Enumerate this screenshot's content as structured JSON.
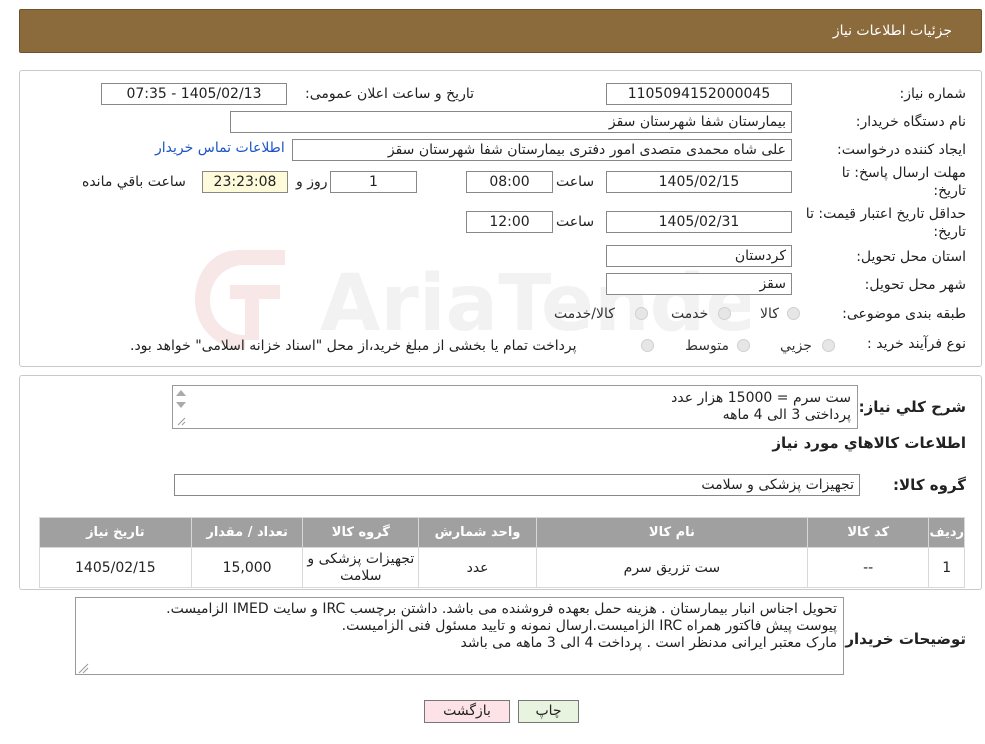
{
  "header": {
    "title": "جزئیات اطلاعات نیاز"
  },
  "form": {
    "need_number_label": "شماره نیاز:",
    "need_number": "1105094152000045",
    "announce_label": "تاریخ و ساعت اعلان عمومی:",
    "announce_value": "1405/02/13 - 07:35",
    "buyer_org_label": "نام دستگاه خریدار:",
    "buyer_org": "بیمارستان شفا شهرستان سقز",
    "creator_label": "ایجاد کننده درخواست:",
    "creator": "علی شاه محمدی متصدی امور دفتری بیمارستان شفا شهرستان سقز",
    "contact_link": "اطلاعات تماس خریدار",
    "deadline_label_1": "مهلت ارسال پاسخ: تا",
    "deadline_label_2": "تاریخ:",
    "deadline_date": "1405/02/15",
    "time_label": "ساعت",
    "deadline_time": "08:00",
    "days_value": "1",
    "days_label": "روز و",
    "remaining_time": "23:23:08",
    "remaining_label": "ساعت باقي مانده",
    "validity_label_1": "حداقل تاریخ اعتبار قیمت: تا",
    "validity_label_2": "تاریخ:",
    "validity_date": "1405/02/31",
    "validity_time": "12:00",
    "province_label": "استان محل تحویل:",
    "province": "کردستان",
    "city_label": "شهر محل تحویل:",
    "city": "سقز",
    "category_label": "طبقه بندی موضوعی:",
    "category_options": [
      "کالا",
      "خدمت",
      "کالا/خدمت"
    ],
    "purchase_type_label": "نوع فرآیند خرید :",
    "purchase_options": [
      "جزیي",
      "متوسط"
    ],
    "purchase_note": "پرداخت تمام یا بخشی از مبلغ خرید،از محل \"اسناد خزانه اسلامی\" خواهد بود."
  },
  "description": {
    "label": "شرح کلي نياز:",
    "line1": "ست سرم = 15000 هزار عدد",
    "line2": "پرداختی 3 الی 4 ماهه"
  },
  "goods_title": "اطلاعات کالاهاي مورد نياز",
  "goods_group_label": "گروه کالا:",
  "goods_group": "تجهیزات پزشکی و سلامت",
  "table": {
    "headers": [
      "رديف",
      "کد کالا",
      "نام کالا",
      "واحد شمارش",
      "گروه کالا",
      "تعداد / مقدار",
      "تاريخ نياز"
    ],
    "rows": [
      [
        "1",
        "--",
        "ست تزریق سرم",
        "عدد",
        "تجهیزات پزشکی و سلامت",
        "15,000",
        "1405/02/15"
      ]
    ]
  },
  "buyer_notes": {
    "label": "توضیحات خریدار:",
    "line1": "تحویل اجناس  انبار بیمارستان . هزینه حمل بعهده فروشنده می باشد.  داشتن برچسب IRC  و سایت  IMED  الزامیست.",
    "line2": "پیوست پیش فاکتور همراه IRC  الزامیست.ارسال نمونه و تایید مسئول فنی الزامیست.",
    "line3": "مارک معتبر ایرانی مدنظر است . پرداخت 4 الی 3 ماهه می باشد"
  },
  "buttons": {
    "print": "چاپ",
    "back": "بازگشت"
  },
  "colors": {
    "header_bg": "#8b6a3b",
    "table_header_bg": "#a0a0a0",
    "link": "#1a55c8"
  }
}
